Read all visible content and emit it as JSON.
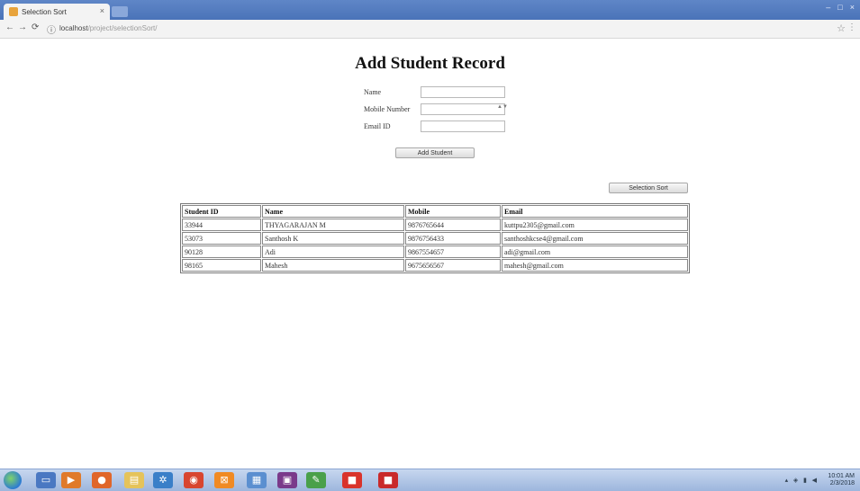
{
  "browser": {
    "tab_title": "Selection Sort",
    "tab_close": "×",
    "url_host": "localhost",
    "url_path": "/project/selectionSort/",
    "back": "←",
    "forward": "→",
    "reload": "⟳",
    "info": "ⓘ",
    "star": "☆",
    "menu": "⋮",
    "win_controls": [
      "–",
      "□",
      "×"
    ]
  },
  "page": {
    "title": "Add Student Record",
    "form": {
      "name_label": "Name",
      "mobile_label": "Mobile Number",
      "email_label": "Email ID",
      "name_value": "",
      "mobile_value": "",
      "email_value": "",
      "spinner": "▲▼"
    },
    "add_button": "Add Student",
    "sort_button": "Selection Sort",
    "table": {
      "headers": [
        "Student ID",
        "Name",
        "Mobile",
        "Email"
      ],
      "rows": [
        [
          "33944",
          "THYAGARAJAN M",
          "9876765644",
          "kuttpu2305@gmail.com"
        ],
        [
          "53073",
          "Santhosh K",
          "9876756433",
          "santhoshkcse4@gmail.com"
        ],
        [
          "90128",
          "Adi",
          "9867554657",
          "adi@gmail.com"
        ],
        [
          "98165",
          "Mahesh",
          "9675656567",
          "mahesh@gmail.com"
        ]
      ]
    }
  },
  "taskbar": {
    "icons": [
      {
        "name": "explorer-icon",
        "glyph": "▭",
        "color": "#4a78c2"
      },
      {
        "name": "media-player-icon",
        "glyph": "▶",
        "color": "#e07a2a"
      },
      {
        "name": "firefox-icon",
        "glyph": "●",
        "color": "#e0662a"
      },
      {
        "name": "folder-icon",
        "glyph": "▤",
        "color": "#e5c35a"
      },
      {
        "name": "network-icon",
        "glyph": "✲",
        "color": "#3a7fc8"
      },
      {
        "name": "chrome-icon",
        "glyph": "◉",
        "color": "#d8452f"
      },
      {
        "name": "xampp-icon",
        "glyph": "⊠",
        "color": "#f08a24"
      },
      {
        "name": "notepad-icon",
        "glyph": "▦",
        "color": "#5b8fd0"
      },
      {
        "name": "winrar-icon",
        "glyph": "▣",
        "color": "#7a3a8a"
      },
      {
        "name": "paint-icon",
        "glyph": "✎",
        "color": "#4aa04a"
      },
      {
        "name": "app-red-icon",
        "glyph": "■",
        "color": "#d9332b"
      },
      {
        "name": "app-red2-icon",
        "glyph": "■",
        "color": "#c92a2a"
      }
    ],
    "tray": "▴ ◈ ▮ ◀",
    "clock_time": "10:01 AM",
    "clock_date": "2/3/2018"
  }
}
